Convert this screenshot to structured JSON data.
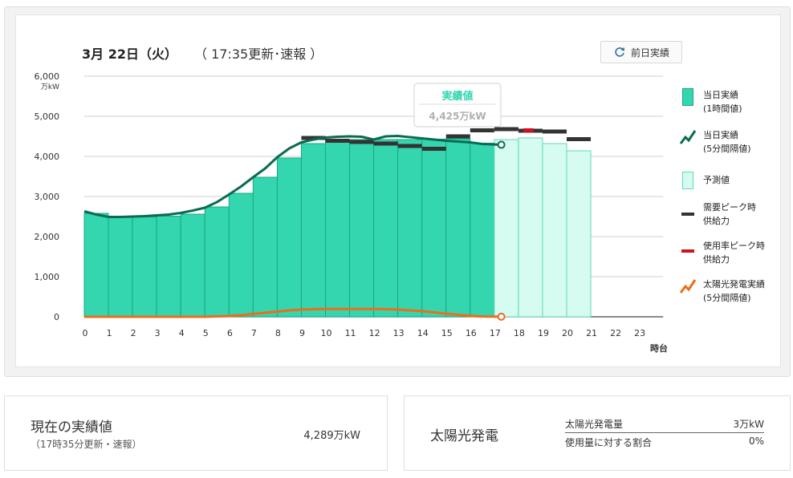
{
  "header": {
    "title": "3月 22日（火）",
    "subtitle": "（ 17:35更新･速報 ）",
    "prev_button_label": "前日実績"
  },
  "chart_data": {
    "type": "bar",
    "y_unit": "万kW",
    "ylim": [
      0,
      6000
    ],
    "y_ticks": [
      0,
      1000,
      2000,
      3000,
      4000,
      5000,
      6000
    ],
    "y_tick_labels": [
      "0",
      "1,000",
      "2,000",
      "3,000",
      "4,000",
      "5,000",
      "6,000"
    ],
    "x_label": "時台",
    "categories": [
      "0",
      "1",
      "2",
      "3",
      "4",
      "5",
      "6",
      "7",
      "8",
      "9",
      "10",
      "11",
      "12",
      "13",
      "14",
      "15",
      "16",
      "17",
      "18",
      "19",
      "20",
      "21",
      "22",
      "23"
    ],
    "series": [
      {
        "name": "当日実績\n(1時間値)",
        "color": "#33d6ae",
        "values": [
          2580,
          2490,
          2490,
          2510,
          2560,
          2740,
          3080,
          3480,
          3960,
          4320,
          4400,
          4420,
          4420,
          4420,
          4430,
          4440,
          4330,
          null,
          null,
          null,
          null,
          null,
          null,
          null
        ]
      },
      {
        "name": "予測値",
        "color": "#d6fbf1",
        "values": [
          null,
          null,
          null,
          null,
          null,
          null,
          null,
          null,
          null,
          null,
          null,
          null,
          null,
          null,
          null,
          null,
          null,
          4420,
          4460,
          4320,
          4140,
          null,
          null,
          null
        ]
      },
      {
        "name": "需要ピーク時\n供給力",
        "color": "#333333",
        "values": [
          null,
          null,
          null,
          null,
          null,
          null,
          null,
          null,
          null,
          4460,
          4390,
          4360,
          4320,
          4260,
          4190,
          4500,
          4650,
          4680,
          4640,
          4620,
          4430,
          null,
          null,
          null
        ]
      },
      {
        "name": "使用率ピーク時\n供給力",
        "color": "#cc1122",
        "values": [
          null,
          null,
          null,
          null,
          null,
          null,
          null,
          null,
          null,
          null,
          null,
          null,
          null,
          null,
          null,
          null,
          null,
          null,
          4650,
          null,
          null,
          null,
          null,
          null
        ]
      },
      {
        "name": "当日実績\n(5分間隔値)",
        "color": "#0b6b52",
        "type": "line",
        "x": [
          0,
          0.5,
          1,
          1.5,
          2,
          2.5,
          3,
          3.5,
          4,
          4.5,
          5,
          5.5,
          6,
          6.5,
          7,
          7.5,
          8,
          8.5,
          9,
          9.5,
          10,
          10.5,
          11,
          11.5,
          12,
          12.5,
          13,
          13.5,
          14,
          14.5,
          15,
          15.5,
          16,
          16.5,
          17.29
        ],
        "values": [
          2630,
          2550,
          2490,
          2490,
          2500,
          2510,
          2530,
          2550,
          2590,
          2650,
          2720,
          2860,
          3050,
          3250,
          3480,
          3700,
          3980,
          4200,
          4350,
          4420,
          4470,
          4490,
          4500,
          4490,
          4420,
          4500,
          4510,
          4480,
          4450,
          4420,
          4390,
          4370,
          4350,
          4310,
          4289
        ]
      },
      {
        "name": "太陽光発電実績\n(5分間隔値)",
        "color": "#ef6c1a",
        "type": "line",
        "x": [
          0,
          5,
          5.5,
          6,
          6.5,
          7,
          7.5,
          8,
          8.5,
          9,
          9.5,
          10,
          10.5,
          11,
          11.5,
          12,
          12.5,
          13,
          13.5,
          14,
          14.5,
          15,
          15.5,
          16,
          16.5,
          17.29
        ],
        "values": [
          0,
          0,
          10,
          20,
          40,
          70,
          100,
          130,
          160,
          180,
          190,
          195,
          195,
          195,
          195,
          195,
          190,
          180,
          160,
          140,
          110,
          80,
          50,
          25,
          8,
          3
        ]
      }
    ]
  },
  "tooltip": {
    "title": "実績値",
    "value": "4,425万kW"
  },
  "card_current": {
    "title": "現在の実績値",
    "sub": "（17時35分更新・速報）",
    "value": "4,289万kW"
  },
  "card_solar": {
    "title": "太陽光発電",
    "row1_label": "太陽光発電量",
    "row1_value": "3万kW",
    "row2_label": "使用量に対する割合",
    "row2_value": "0%"
  }
}
